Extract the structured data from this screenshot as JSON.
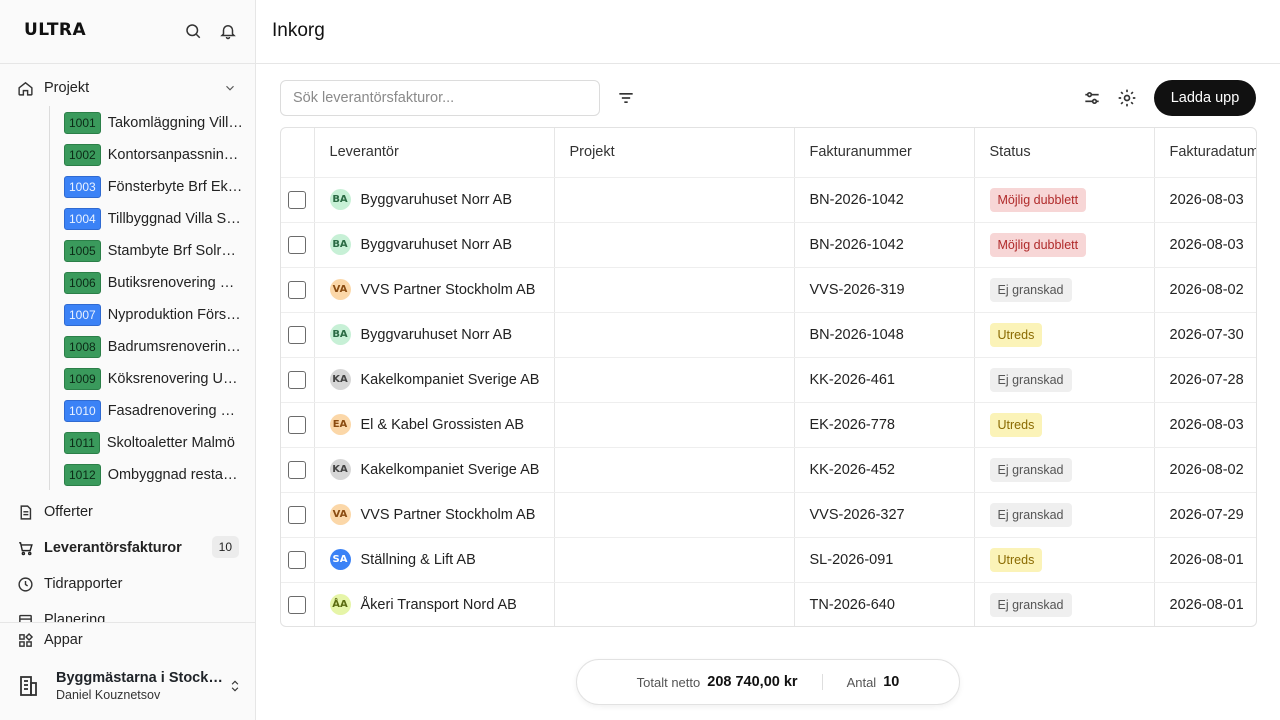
{
  "sidebar": {
    "brand": "ULTRA",
    "nav": {
      "projekt": "Projekt",
      "offerter": "Offerter",
      "leverantorsfakturor": "Leverantörsfakturor",
      "leverantorsfakturor_count": "10",
      "tidrapporter": "Tidrapporter",
      "planering_partial": "Planering",
      "appar": "Appar"
    },
    "projects": [
      {
        "code": "1001",
        "name": "Takomläggning Villa Lindqvist",
        "color": "green"
      },
      {
        "code": "1002",
        "name": "Kontorsanpassning Kv. Eken",
        "color": "green"
      },
      {
        "code": "1003",
        "name": "Fönsterbyte Brf Ekbacken",
        "color": "blue"
      },
      {
        "code": "1004",
        "name": "Tillbyggnad Villa Strand",
        "color": "blue"
      },
      {
        "code": "1005",
        "name": "Stambyte Brf Solrosen",
        "color": "green"
      },
      {
        "code": "1006",
        "name": "Butiksrenovering Centrum",
        "color": "green"
      },
      {
        "code": "1007",
        "name": "Nyproduktion Förskola",
        "color": "blue"
      },
      {
        "code": "1008",
        "name": "Badrumsrenovering Lund",
        "color": "green"
      },
      {
        "code": "1009",
        "name": "Köksrenovering Uppsala",
        "color": "green"
      },
      {
        "code": "1010",
        "name": "Fasadrenovering Brf Lärken",
        "color": "blue"
      },
      {
        "code": "1011",
        "name": "Skoltoaletter Malmö",
        "color": "green"
      },
      {
        "code": "1012",
        "name": "Ombyggnad restaurang",
        "color": "green"
      }
    ],
    "org": {
      "name": "Byggmästarna i Stockholm AB",
      "user": "Daniel Kouznetsov"
    }
  },
  "header": {
    "title": "Inkorg"
  },
  "toolbar": {
    "search_placeholder": "Sök leverantörsfakturor...",
    "upload_label": "Ladda upp"
  },
  "table": {
    "columns": [
      "Leverantör",
      "Projekt",
      "Fakturanummer",
      "Status",
      "Fakturadatum"
    ],
    "rows": [
      {
        "initials": "BA",
        "avatar": "BA",
        "supplier": "Byggvaruhuset Norr AB",
        "project": "",
        "invoice": "BN-2026-1042",
        "status": "Möjlig dubblett",
        "status_type": "dup",
        "date": "2026-08-03"
      },
      {
        "initials": "BA",
        "avatar": "BA",
        "supplier": "Byggvaruhuset Norr AB",
        "project": "",
        "invoice": "BN-2026-1042",
        "status": "Möjlig dubblett",
        "status_type": "dup",
        "date": "2026-08-03"
      },
      {
        "initials": "VA",
        "avatar": "VA",
        "supplier": "VVS Partner Stockholm AB",
        "project": "",
        "invoice": "VVS-2026-319",
        "status": "Ej granskad",
        "status_type": "ej",
        "date": "2026-08-02"
      },
      {
        "initials": "BA",
        "avatar": "BA",
        "supplier": "Byggvaruhuset Norr AB",
        "project": "",
        "invoice": "BN-2026-1048",
        "status": "Utreds",
        "status_type": "utr",
        "date": "2026-07-30"
      },
      {
        "initials": "KA",
        "avatar": "KA",
        "supplier": "Kakelkompaniet Sverige AB",
        "project": "",
        "invoice": "KK-2026-461",
        "status": "Ej granskad",
        "status_type": "ej",
        "date": "2026-07-28"
      },
      {
        "initials": "EA",
        "avatar": "EA",
        "supplier": "El & Kabel Grossisten AB",
        "project": "",
        "invoice": "EK-2026-778",
        "status": "Utreds",
        "status_type": "utr",
        "date": "2026-08-03"
      },
      {
        "initials": "KA",
        "avatar": "KA",
        "supplier": "Kakelkompaniet Sverige AB",
        "project": "",
        "invoice": "KK-2026-452",
        "status": "Ej granskad",
        "status_type": "ej",
        "date": "2026-08-02"
      },
      {
        "initials": "VA",
        "avatar": "VA",
        "supplier": "VVS Partner Stockholm AB",
        "project": "",
        "invoice": "VVS-2026-327",
        "status": "Ej granskad",
        "status_type": "ej",
        "date": "2026-07-29"
      },
      {
        "initials": "SA",
        "avatar": "SA",
        "supplier": "Ställning & Lift AB",
        "project": "",
        "invoice": "SL-2026-091",
        "status": "Utreds",
        "status_type": "utr",
        "date": "2026-08-01"
      },
      {
        "initials": "ÅA",
        "avatar": "AA",
        "supplier": "Åkeri Transport Nord AB",
        "project": "",
        "invoice": "TN-2026-640",
        "status": "Ej granskad",
        "status_type": "ej",
        "date": "2026-08-01"
      }
    ]
  },
  "summary": {
    "net_label": "Totalt netto",
    "net_value": "208 740,00 kr",
    "count_label": "Antal",
    "count_value": "10"
  },
  "colors": {
    "accent": "#111111",
    "project_green": "#3a9a5c",
    "project_blue": "#3b82f6",
    "status_duplicate_bg": "#f7d6d6",
    "status_review_bg": "#fbf3b8"
  }
}
